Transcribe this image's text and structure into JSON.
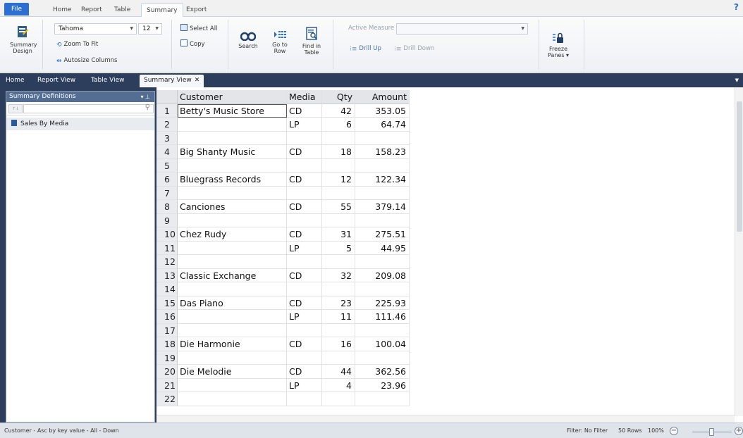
{
  "ribbon_tabs": [
    "File",
    "Home",
    "Report",
    "Table",
    "Summary",
    "Export"
  ],
  "help_label": "?",
  "ribbon": {
    "summary_design": {
      "line1": "Summary",
      "line2": "Design"
    },
    "font_name": "Tahoma",
    "font_size": "12",
    "zoom_to_fit": "Zoom To Fit",
    "autosize_columns": "Autosize Columns",
    "select_all": "Select All",
    "copy": "Copy",
    "search": "Search",
    "go_to_row": {
      "line1": "Go to",
      "line2": "Row"
    },
    "find_in_table": {
      "line1": "Find in",
      "line2": "Table"
    },
    "active_measure": "Active Measure",
    "drill_up": "Drill Up",
    "drill_down": "Drill Down",
    "freeze_panes": {
      "line1": "Freeze",
      "line2": "Panes ▾"
    }
  },
  "doc_tabs": [
    "Home",
    "Report View",
    "Table View",
    "Summary View"
  ],
  "doc_tab_close": "✕",
  "left_panel": {
    "title": "Summary Definitions",
    "sort_label": "↑↓",
    "item": "Sales By Media"
  },
  "table": {
    "headers": [
      "Customer",
      "Media",
      "Qty",
      "Amount"
    ],
    "rows": [
      {
        "n": "1",
        "customer": "Betty's Music Store",
        "media": "CD",
        "qty": "42",
        "amount": "353.05"
      },
      {
        "n": "2",
        "customer": "",
        "media": "LP",
        "qty": "6",
        "amount": "64.74"
      },
      {
        "n": "3",
        "customer": "",
        "media": "",
        "qty": "",
        "amount": ""
      },
      {
        "n": "4",
        "customer": "Big Shanty Music",
        "media": "CD",
        "qty": "18",
        "amount": "158.23"
      },
      {
        "n": "5",
        "customer": "",
        "media": "",
        "qty": "",
        "amount": ""
      },
      {
        "n": "6",
        "customer": "Bluegrass Records",
        "media": "CD",
        "qty": "12",
        "amount": "122.34"
      },
      {
        "n": "7",
        "customer": "",
        "media": "",
        "qty": "",
        "amount": ""
      },
      {
        "n": "8",
        "customer": "Canciones",
        "media": "CD",
        "qty": "55",
        "amount": "379.14"
      },
      {
        "n": "9",
        "customer": "",
        "media": "",
        "qty": "",
        "amount": ""
      },
      {
        "n": "10",
        "customer": "Chez Rudy",
        "media": "CD",
        "qty": "31",
        "amount": "275.51"
      },
      {
        "n": "11",
        "customer": "",
        "media": "LP",
        "qty": "5",
        "amount": "44.95"
      },
      {
        "n": "12",
        "customer": "",
        "media": "",
        "qty": "",
        "amount": ""
      },
      {
        "n": "13",
        "customer": "Classic Exchange",
        "media": "CD",
        "qty": "32",
        "amount": "209.08"
      },
      {
        "n": "14",
        "customer": "",
        "media": "",
        "qty": "",
        "amount": ""
      },
      {
        "n": "15",
        "customer": "Das Piano",
        "media": "CD",
        "qty": "23",
        "amount": "225.93"
      },
      {
        "n": "16",
        "customer": "",
        "media": "LP",
        "qty": "11",
        "amount": "111.46"
      },
      {
        "n": "17",
        "customer": "",
        "media": "",
        "qty": "",
        "amount": ""
      },
      {
        "n": "18",
        "customer": "Die Harmonie",
        "media": "CD",
        "qty": "16",
        "amount": "100.04"
      },
      {
        "n": "19",
        "customer": "",
        "media": "",
        "qty": "",
        "amount": ""
      },
      {
        "n": "20",
        "customer": "Die Melodie",
        "media": "CD",
        "qty": "44",
        "amount": "362.56"
      },
      {
        "n": "21",
        "customer": "",
        "media": "LP",
        "qty": "4",
        "amount": "23.96"
      },
      {
        "n": "22",
        "customer": "",
        "media": "",
        "qty": "",
        "amount": ""
      }
    ]
  },
  "status": {
    "left": "Customer - Asc by key value - All - Down",
    "filter": "Filter: No Filter",
    "rows": "50 Rows",
    "zoom": "100%"
  },
  "colors": {
    "accent": "#2d6fd0",
    "dark_bar": "#2c3e5c",
    "panel_header": "#536e92"
  },
  "icons": [
    "summary-design-icon",
    "zoom-to-fit-icon",
    "autosize-columns-icon",
    "select-all-icon",
    "copy-icon",
    "search-binoculars-icon",
    "go-to-row-icon",
    "find-in-table-icon",
    "drill-up-icon",
    "drill-down-icon",
    "freeze-panes-icon",
    "pin-icon",
    "magnifier-icon",
    "table-icon"
  ]
}
